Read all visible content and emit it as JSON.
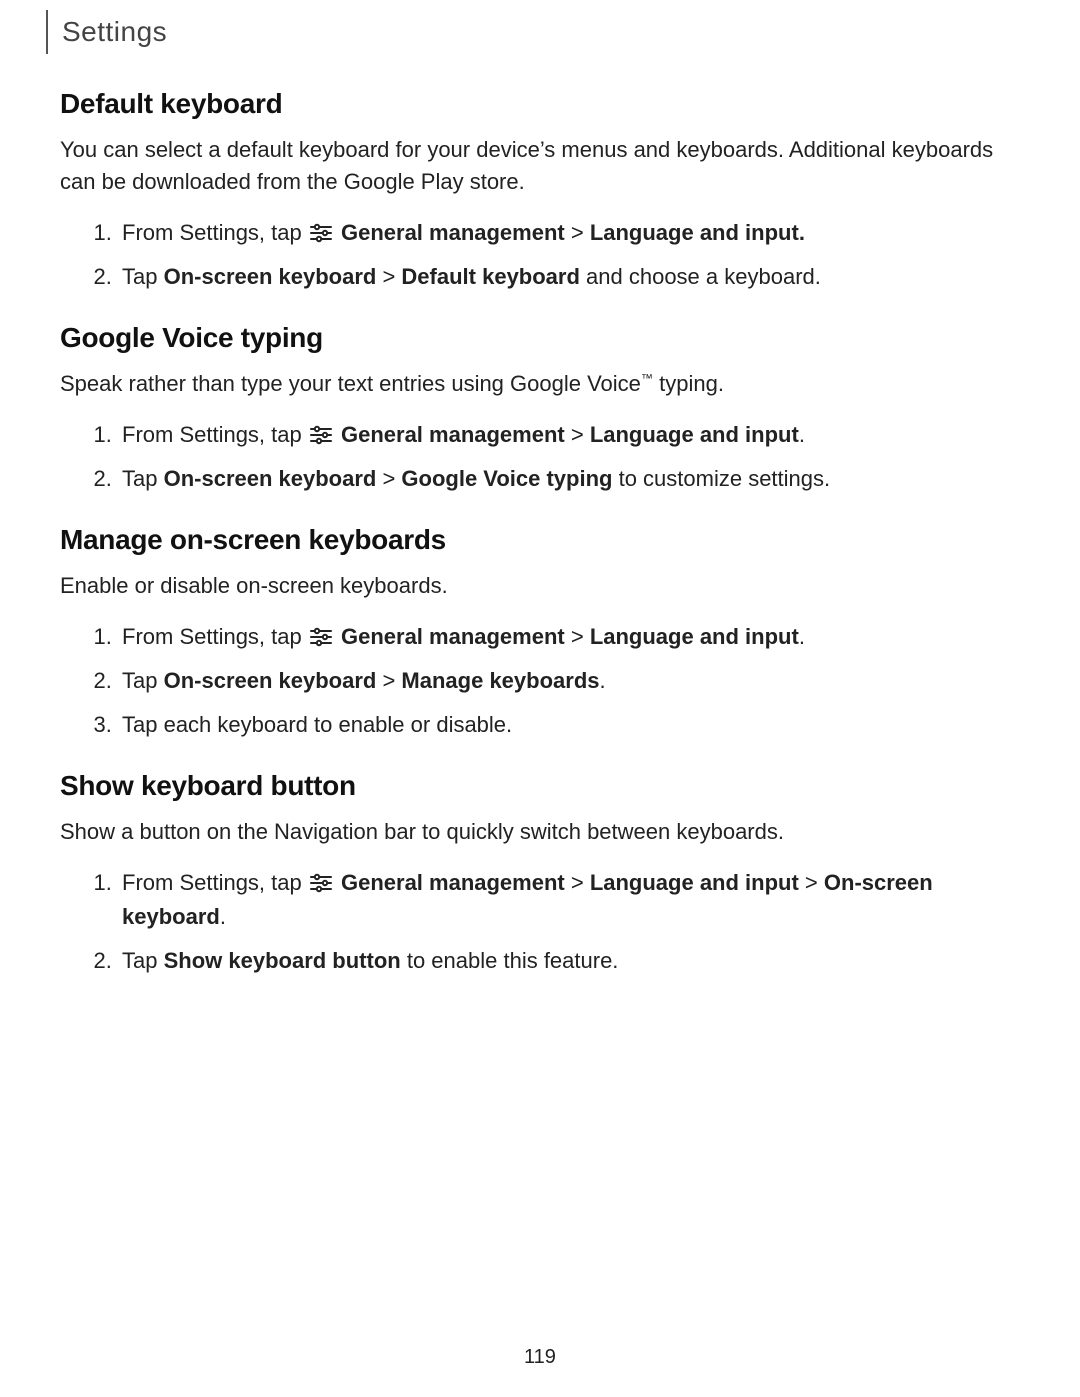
{
  "breadcrumb": "Settings",
  "page_number": "119",
  "common": {
    "from_settings_tap": "From Settings, tap ",
    "general_management": "General management",
    "language_and_input": "Language and input",
    "on_screen_keyboard": "On-screen keyboard",
    "tap": "Tap "
  },
  "sections": {
    "default_kb": {
      "title": "Default keyboard",
      "intro": "You can select a default keyboard for your device’s menus and keyboards. Additional keyboards can be downloaded from the Google Play store.",
      "step2_bold": "Default keyboard",
      "step2_tail": " and choose a keyboard."
    },
    "gvt": {
      "title": "Google Voice typing",
      "intro_pre": "Speak rather than type your text entries using Google Voice",
      "intro_post": " typing.",
      "step2_bold": "Google Voice typing",
      "step2_tail": " to customize settings."
    },
    "manage": {
      "title": "Manage on-screen keyboards",
      "intro": "Enable or disable on-screen keyboards.",
      "step2_bold": "Manage keyboards",
      "step3": "Tap each keyboard to enable or disable."
    },
    "show_btn": {
      "title": "Show keyboard button",
      "intro": "Show a button on the Navigation bar to quickly switch between keyboards.",
      "step2_bold": "Show keyboard button",
      "step2_tail": " to enable this feature."
    }
  }
}
